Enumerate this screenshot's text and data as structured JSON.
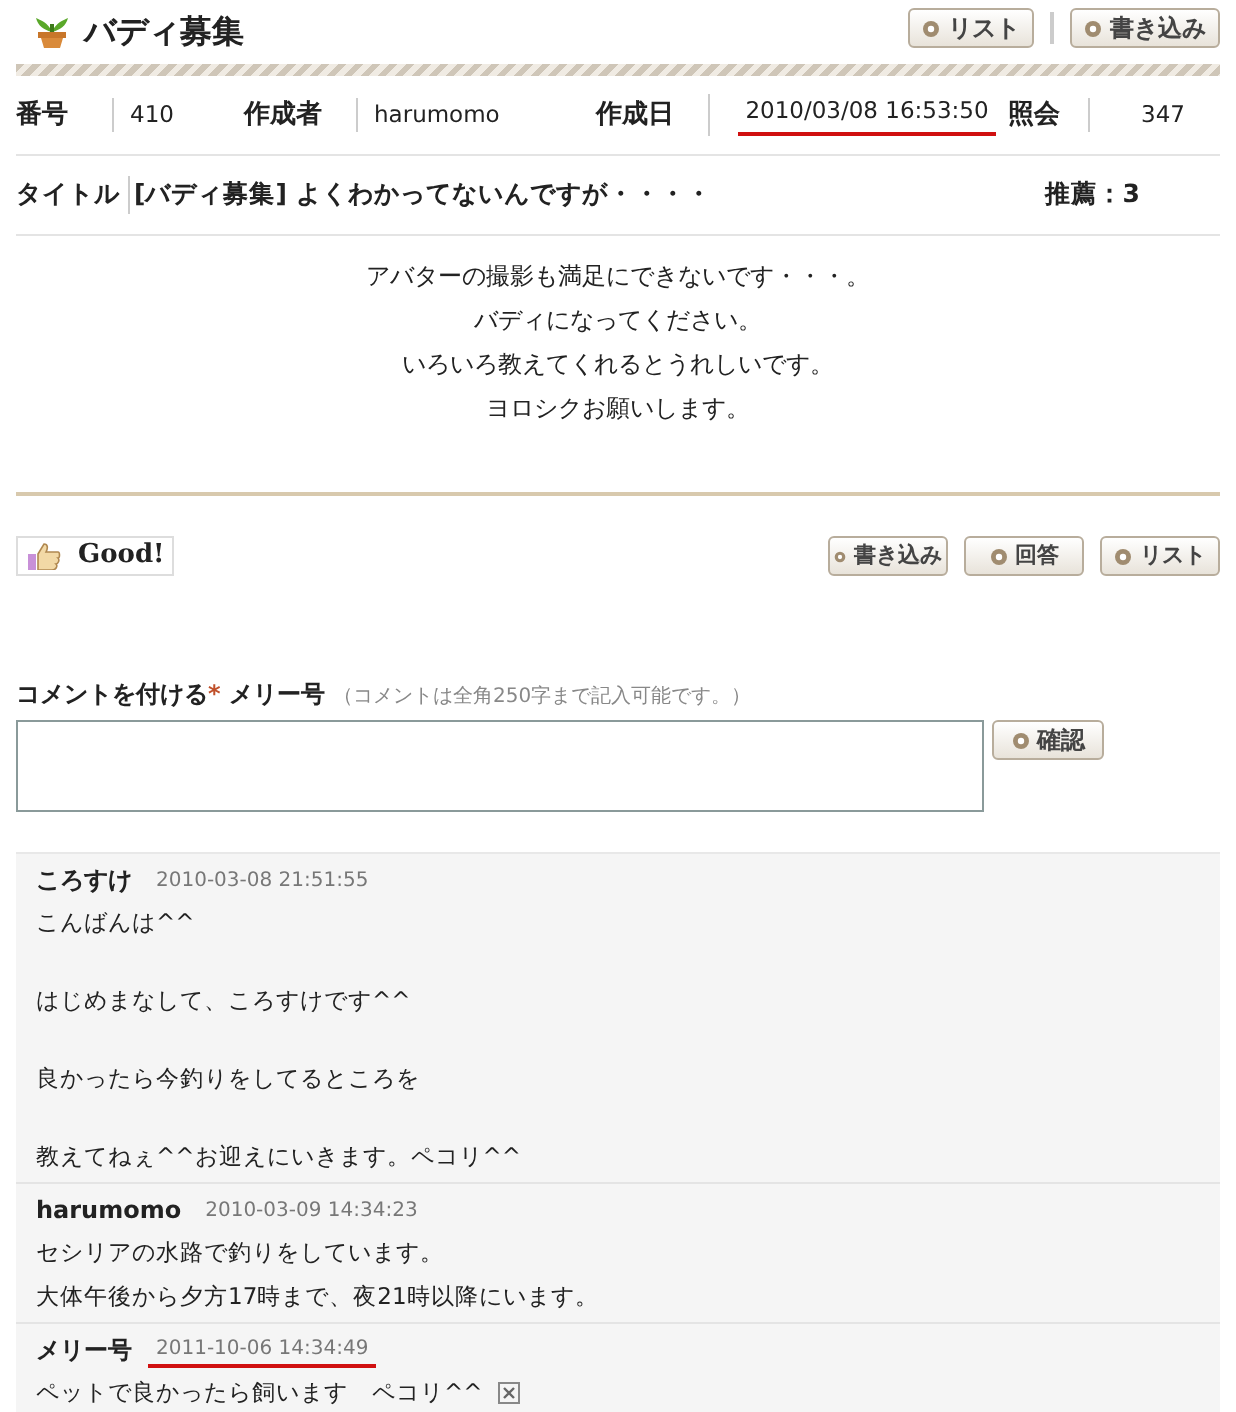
{
  "header": {
    "title": "バディ募集",
    "buttons": [
      "リスト",
      "書き込み"
    ]
  },
  "info": [
    {
      "label": "番号",
      "value": "410",
      "marked": false
    },
    {
      "label": "作成者",
      "value": "harumomo",
      "marked": false
    },
    {
      "label": "作成日",
      "value": "2010/03/08 16:53:50",
      "marked": true
    },
    {
      "label": "照会",
      "value": "347",
      "marked": false
    }
  ],
  "post": {
    "title_label": "タイトル",
    "title": "[バディ募集] よくわかってないんですが・・・・",
    "recommend": "推薦：3",
    "body": [
      "アバターの撮影も満足にできないです・・・。",
      "バディになってください。",
      "いろいろ教えてくれるとうれしいです。",
      "ヨロシクお願いします。"
    ]
  },
  "good_button": "Good!",
  "actions": [
    "書き込み",
    "回答",
    "リスト"
  ],
  "comment_form": {
    "label": "コメントを付ける",
    "required_mark": "*",
    "user": "メリー号",
    "note": "（コメントは全角250字まで記入可能です。）",
    "button": "確認"
  },
  "comments": [
    {
      "author": "ころすけ",
      "time": "2010-03-08 21:51:55",
      "marked": false,
      "double_spaced": true,
      "deletable": false,
      "lines": [
        "こんばんは^^",
        "はじめまなして、ころすけです^^",
        "良かったら今釣りをしてるところを",
        "教えてねぇ^^お迎えにいきます。ペコリ^^"
      ]
    },
    {
      "author": "harumomo",
      "time": "2010-03-09 14:34:23",
      "marked": false,
      "double_spaced": false,
      "deletable": false,
      "lines": [
        "セシリアの水路で釣りをしています。",
        "大体午後から夕方17時まで、夜21時以降にいます。"
      ]
    },
    {
      "author": "メリー号",
      "time": "2011-10-06 14:34:49",
      "marked": true,
      "double_spaced": false,
      "deletable": true,
      "lines": [
        "ペットで良かったら飼います　ペコリ^^"
      ]
    }
  ]
}
